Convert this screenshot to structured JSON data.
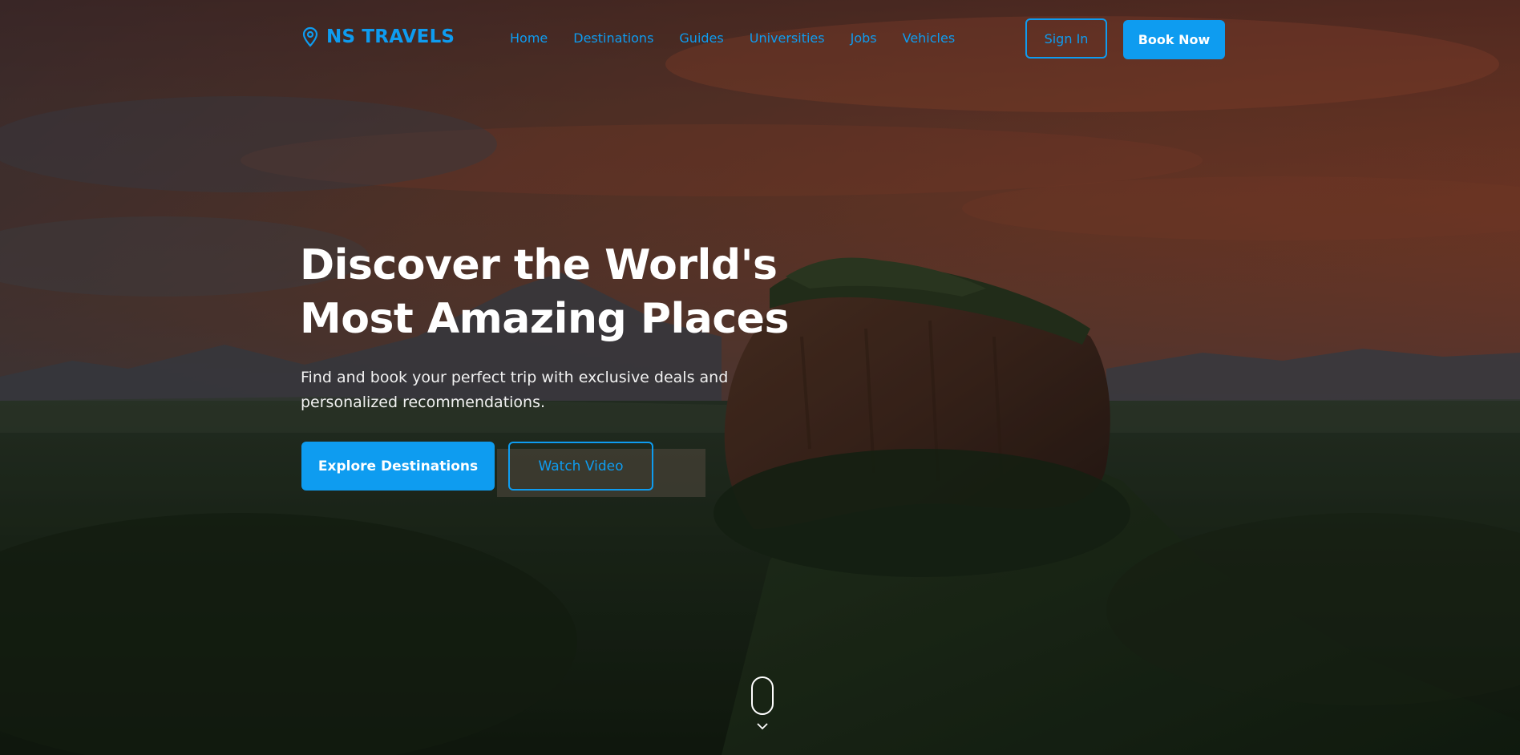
{
  "brand": {
    "name": "NS TRAVELS",
    "icon": "map-pin-icon",
    "color": "#0e9cf0"
  },
  "nav": {
    "items": [
      {
        "label": "Home"
      },
      {
        "label": "Destinations"
      },
      {
        "label": "Guides"
      },
      {
        "label": "Universities"
      },
      {
        "label": "Jobs"
      },
      {
        "label": "Vehicles"
      }
    ]
  },
  "header_actions": {
    "sign_in": "Sign In",
    "book_now": "Book Now"
  },
  "hero": {
    "title_line1": "Discover the World's",
    "title_line2": "Most Amazing Places",
    "subtitle_line1": "Find and book your perfect trip with exclusive deals and",
    "subtitle_line2": "personalized recommendations.",
    "primary_cta": "Explore Destinations",
    "secondary_cta": "Watch Video",
    "background": "sunset-rock-fortress-over-forest"
  },
  "scroll_indicator": {
    "icon": "mouse-scroll-icon",
    "chevron": "chevron-down-icon"
  },
  "colors": {
    "accent": "#0e9cf0",
    "text_light": "#ffffff"
  }
}
